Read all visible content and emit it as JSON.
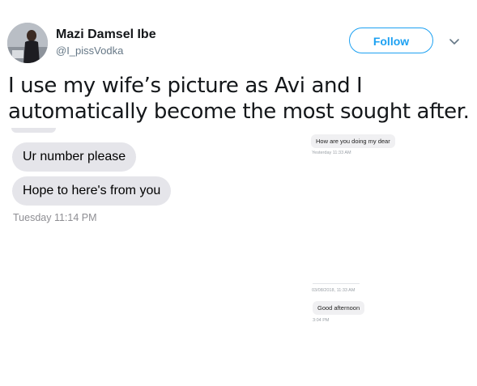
{
  "tweet": {
    "display_name": "Mazi Damsel Ibe",
    "handle": "@I_pissVodka",
    "follow_label": "Follow",
    "text": "I use my wife’s picture as Avi and I automatically become the most sought after."
  },
  "screenshot_left": {
    "messages": [
      {
        "text": "Ur number please"
      },
      {
        "text": "Hope to here's from you"
      }
    ],
    "timestamp": "Tuesday 11:14 PM"
  },
  "screenshot_right": {
    "message_1": "How are you doing my dear",
    "meta_1": "Yesterday 11:33 AM",
    "date_divider": "03/08/2018, 11:33 AM",
    "message_2": "Good afternoon",
    "meta_2": "3:04 PM"
  },
  "colors": {
    "accent": "#1da1f2",
    "bubble_gray": "#e5e5ea",
    "secondary_text": "#657786"
  },
  "icons": {
    "caret": "chevron-down-icon"
  }
}
